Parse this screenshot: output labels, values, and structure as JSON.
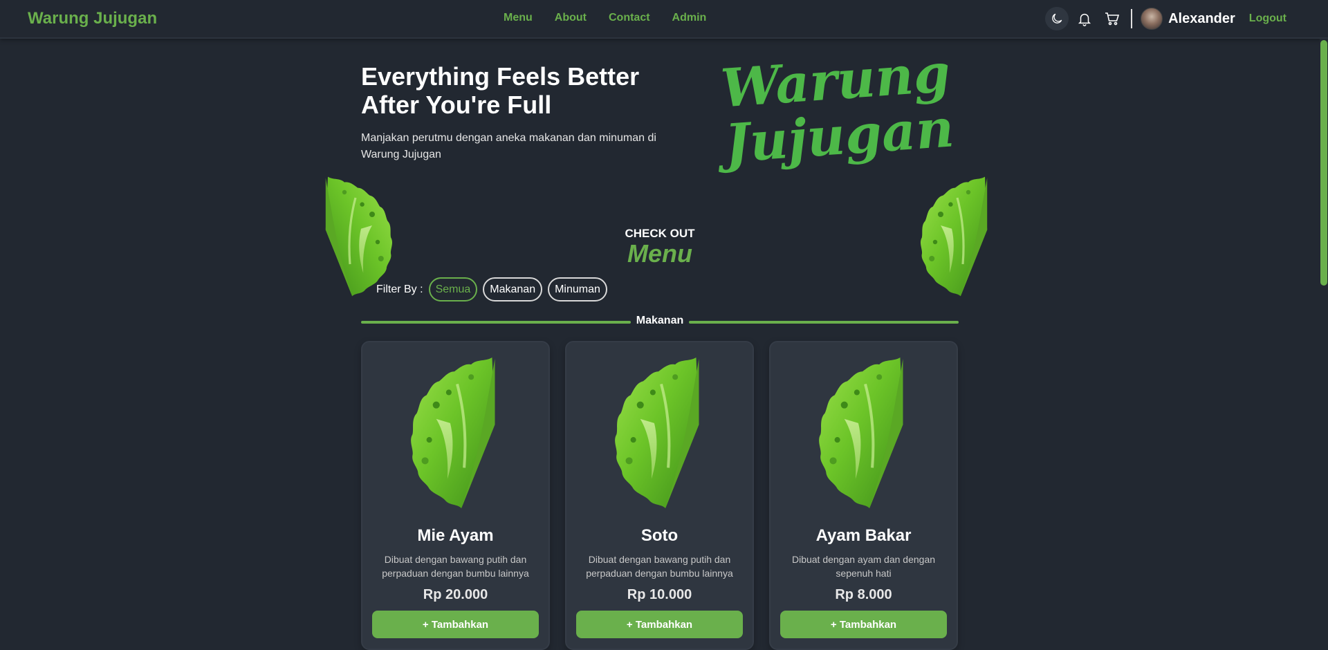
{
  "navbar": {
    "brand": "Warung Jujugan",
    "links": [
      "Menu",
      "About",
      "Contact",
      "Admin"
    ],
    "icons": [
      "moon-icon",
      "bell-icon",
      "cart-icon"
    ],
    "username": "Alexander",
    "logout": "Logout"
  },
  "hero": {
    "title": "Everything Feels Better After You're Full",
    "subtitle": "Manjakan perutmu dengan aneka makanan dan minuman di Warung Jujugan",
    "logo_line1": "Warung",
    "logo_line2": "Jujugan"
  },
  "menu_section": {
    "eyebrow": "CHECK OUT",
    "heading": "Menu",
    "filter_label": "Filter By :",
    "filters": [
      "Semua",
      "Makanan",
      "Minuman"
    ],
    "active_filter": "Semua",
    "category": "Makanan"
  },
  "items": [
    {
      "name": "Mie Ayam",
      "description": "Dibuat dengan bawang putih dan perpaduan dengan bumbu lainnya",
      "price": "Rp 20.000",
      "button": "+ Tambahkan"
    },
    {
      "name": "Soto",
      "description": "Dibuat dengan bawang putih dan perpaduan dengan bumbu lainnya",
      "price": "Rp 10.000",
      "button": "+ Tambahkan"
    },
    {
      "name": "Ayam Bakar",
      "description": "Dibuat dengan ayam dan dengan sepenuh hati",
      "price": "Rp 8.000",
      "button": "+ Tambahkan"
    }
  ],
  "colors": {
    "background": "#222831",
    "accent": "#6ab04c",
    "card": "#2f3640"
  }
}
